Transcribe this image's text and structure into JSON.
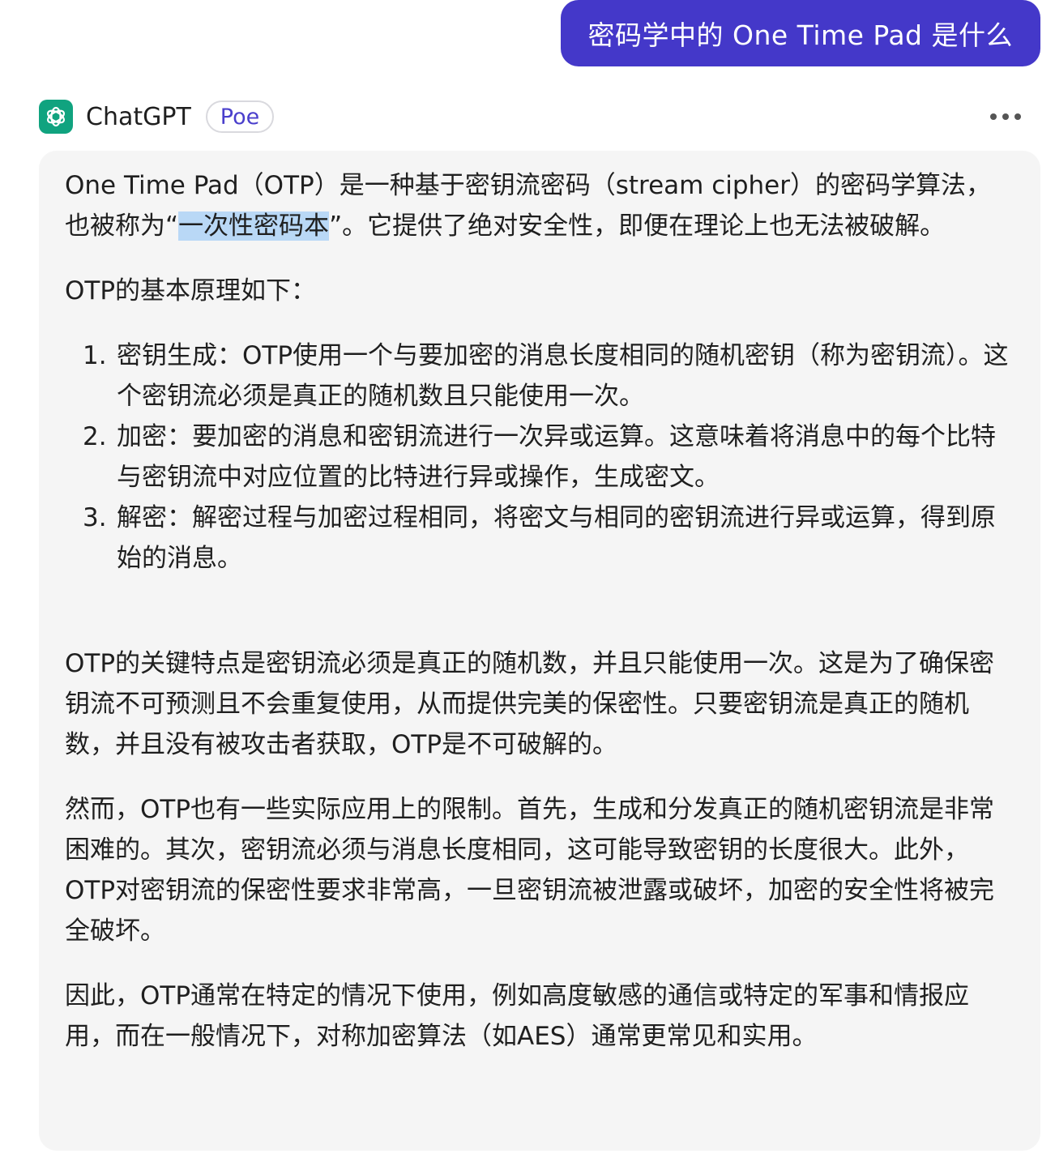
{
  "user_message": "密码学中的 One Time Pad 是什么",
  "bot": {
    "name": "ChatGPT",
    "badge": "Poe",
    "colors": {
      "avatar_bg": "#10a37f",
      "user_bubble_bg": "#4438c9",
      "badge_text": "#4a3fcc"
    }
  },
  "response": {
    "p1_before": "One Time Pad（OTP）是一种基于密钥流密码（stream cipher）的密码学算法，也被称为“",
    "p1_highlight": "一次性密码本",
    "p1_after": "”。它提供了绝对安全性，即便在理论上也无法被破解。",
    "p2": "OTP的基本原理如下：",
    "steps": [
      {
        "num": "1.",
        "text": "密钥生成：OTP使用一个与要加密的消息长度相同的随机密钥（称为密钥流）。这个密钥流必须是真正的随机数且只能使用一次。"
      },
      {
        "num": "2.",
        "text": "加密：要加密的消息和密钥流进行一次异或运算。这意味着将消息中的每个比特与密钥流中对应位置的比特进行异或操作，生成密文。"
      },
      {
        "num": "3.",
        "text": "解密：解密过程与加密过程相同，将密文与相同的密钥流进行异或运算，得到原始的消息。"
      }
    ],
    "p3": "OTP的关键特点是密钥流必须是真正的随机数，并且只能使用一次。这是为了确保密钥流不可预测且不会重复使用，从而提供完美的保密性。只要密钥流是真正的随机数，并且没有被攻击者获取，OTP是不可破解的。",
    "p4": "然而，OTP也有一些实际应用上的限制。首先，生成和分发真正的随机密钥流是非常困难的。其次，密钥流必须与消息长度相同，这可能导致密钥的长度很大。此外，OTP对密钥流的保密性要求非常高，一旦密钥流被泄露或破坏，加密的安全性将被完全破坏。",
    "p5": "因此，OTP通常在特定的情况下使用，例如高度敏感的通信或特定的军事和情报应用，而在一般情况下，对称加密算法（如AES）通常更常见和实用。"
  }
}
